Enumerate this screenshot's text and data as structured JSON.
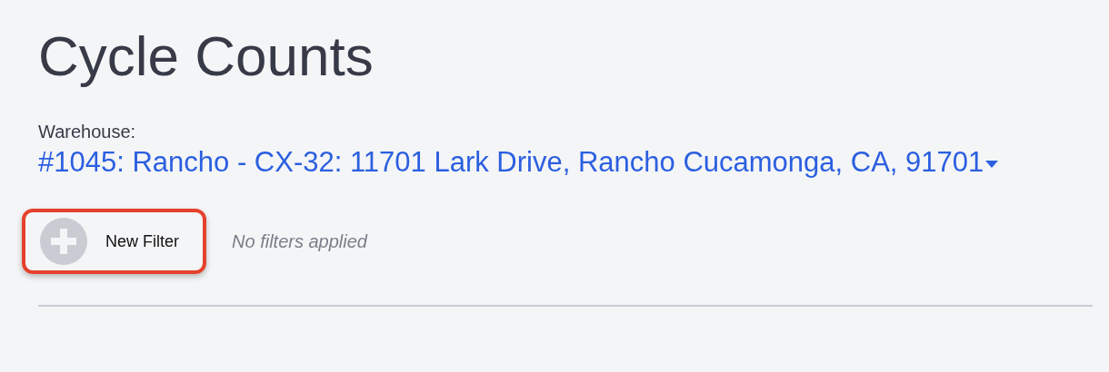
{
  "title": "Cycle Counts",
  "warehouse": {
    "label": "Warehouse:",
    "value": "#1045: Rancho - CX-32: 11701 Lark Drive, Rancho Cucamonga, CA, 91701"
  },
  "filters": {
    "button": {
      "label": "New Filter",
      "highlighted": true
    },
    "empty_text": "No filters applied"
  }
}
